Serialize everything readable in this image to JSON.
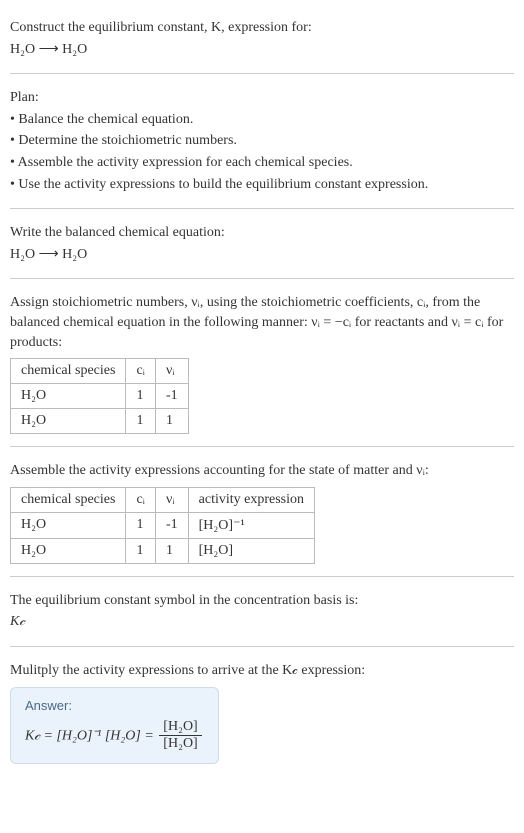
{
  "intro": {
    "prompt_line1": "Construct the equilibrium constant, K, expression for:",
    "equation": "H₂O ⟶ H₂O"
  },
  "plan": {
    "heading": "Plan:",
    "items": [
      "• Balance the chemical equation.",
      "• Determine the stoichiometric numbers.",
      "• Assemble the activity expression for each chemical species.",
      "• Use the activity expressions to build the equilibrium constant expression."
    ]
  },
  "balanced": {
    "heading": "Write the balanced chemical equation:",
    "equation": "H₂O ⟶ H₂O"
  },
  "stoich": {
    "heading_part1": "Assign stoichiometric numbers, νᵢ, using the stoichiometric coefficients, cᵢ, from the balanced chemical equation in the following manner: νᵢ = −cᵢ for reactants and νᵢ = cᵢ for products:",
    "table": {
      "headers": [
        "chemical species",
        "cᵢ",
        "νᵢ"
      ],
      "rows": [
        [
          "H₂O",
          "1",
          "-1"
        ],
        [
          "H₂O",
          "1",
          "1"
        ]
      ]
    }
  },
  "activity": {
    "heading": "Assemble the activity expressions accounting for the state of matter and νᵢ:",
    "table": {
      "headers": [
        "chemical species",
        "cᵢ",
        "νᵢ",
        "activity expression"
      ],
      "rows": [
        [
          "H₂O",
          "1",
          "-1",
          "[H₂O]⁻¹"
        ],
        [
          "H₂O",
          "1",
          "1",
          "[H₂O]"
        ]
      ]
    }
  },
  "symbol": {
    "heading": "The equilibrium constant symbol in the concentration basis is:",
    "value": "K𝒸"
  },
  "multiply": {
    "heading": "Mulitply the activity expressions to arrive at the K𝒸 expression:"
  },
  "answer": {
    "label": "Answer:",
    "lhs": "K𝒸 = [H₂O]⁻¹ [H₂O] =",
    "frac_num": "[H₂O]",
    "frac_den": "[H₂O]"
  },
  "chart_data": {
    "type": "table",
    "tables": [
      {
        "title": "Stoichiometric numbers",
        "headers": [
          "chemical species",
          "c_i",
          "v_i"
        ],
        "rows": [
          {
            "chemical species": "H2O",
            "c_i": 1,
            "v_i": -1
          },
          {
            "chemical species": "H2O",
            "c_i": 1,
            "v_i": 1
          }
        ]
      },
      {
        "title": "Activity expressions",
        "headers": [
          "chemical species",
          "c_i",
          "v_i",
          "activity expression"
        ],
        "rows": [
          {
            "chemical species": "H2O",
            "c_i": 1,
            "v_i": -1,
            "activity expression": "[H2O]^-1"
          },
          {
            "chemical species": "H2O",
            "c_i": 1,
            "v_i": 1,
            "activity expression": "[H2O]"
          }
        ]
      }
    ]
  }
}
